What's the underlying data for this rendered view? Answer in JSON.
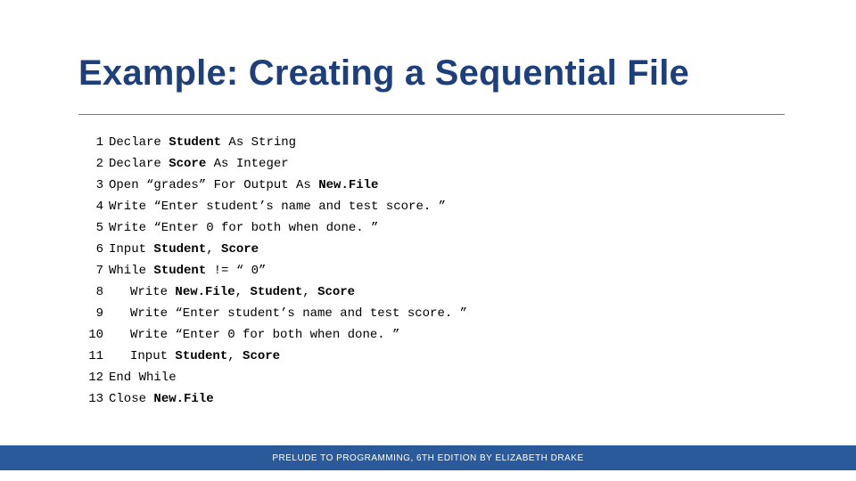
{
  "title": "Example: Creating a Sequential File",
  "code": {
    "l1": {
      "n": "1",
      "t1": "Declare ",
      "b1": "Student",
      "t2": " As String"
    },
    "l2": {
      "n": "2",
      "t1": "Declare ",
      "b1": "Score",
      "t2": " As Integer"
    },
    "l3": {
      "n": "3",
      "t1": "Open “grades” For Output As ",
      "b1": "New.File"
    },
    "l4": {
      "n": "4",
      "t1": "Write “Enter student’s name and test score. ”"
    },
    "l5": {
      "n": "5",
      "t1": "Write “Enter 0 for both when done. ”"
    },
    "l6": {
      "n": "6",
      "t1": "Input ",
      "b1": "Student",
      "t2": ", ",
      "b2": "Score"
    },
    "l7": {
      "n": "7",
      "t1": "While ",
      "b1": "Student",
      "t2": " != “ 0”"
    },
    "l8": {
      "n": "8",
      "t1": "Write ",
      "b1": "New.File",
      "t2": ", ",
      "b2": "Student",
      "t3": ", ",
      "b3": "Score"
    },
    "l9": {
      "n": "9",
      "t1": "Write “Enter student’s name and test score. ”"
    },
    "l10": {
      "n": "10",
      "t1": "Write “Enter 0 for both when done. ”"
    },
    "l11": {
      "n": "11",
      "t1": "Input ",
      "b1": "Student",
      "t2": ", ",
      "b2": "Score"
    },
    "l12": {
      "n": "12",
      "t1": "End While"
    },
    "l13": {
      "n": "13",
      "t1": "Close ",
      "b1": "New.File"
    }
  },
  "footer": "PRELUDE TO PROGRAMMING, 6TH EDITION BY ELIZABETH DRAKE"
}
